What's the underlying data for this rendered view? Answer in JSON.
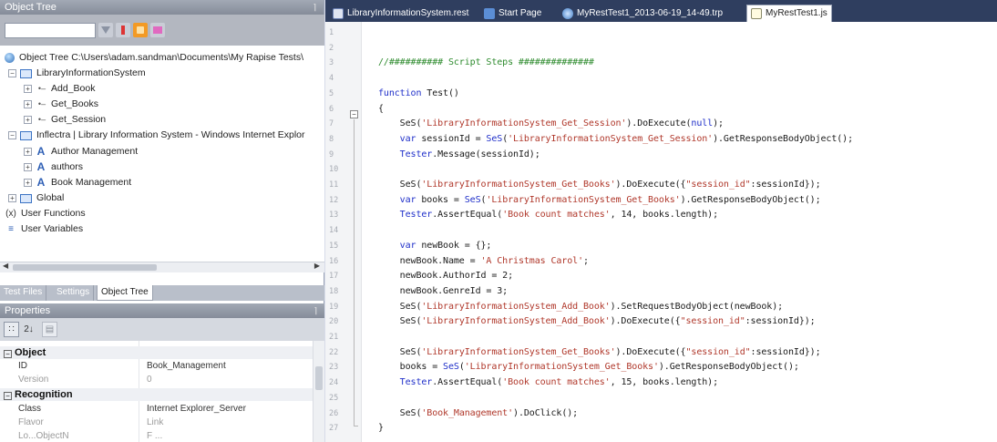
{
  "object_tree": {
    "title": "Object Tree",
    "pin_glyph": "⌉",
    "search_value": "",
    "nodes": [
      {
        "label": "Object Tree C:\\Users\\adam.sandman\\Documents\\My Rapise Tests\\",
        "icon": "database-icon"
      },
      {
        "label": "LibraryInformationSystem",
        "icon": "folder-icon",
        "expander": "−"
      },
      {
        "label": "Add_Book",
        "icon": "connection-icon",
        "expander": "+"
      },
      {
        "label": "Get_Books",
        "icon": "connection-icon",
        "expander": "+"
      },
      {
        "label": "Get_Session",
        "icon": "connection-icon",
        "expander": "+"
      },
      {
        "label": "Inflectra | Library Information System - Windows Internet Explor",
        "icon": "folder-icon",
        "expander": "−"
      },
      {
        "label": "Author Management",
        "icon": "a-icon",
        "expander": "+"
      },
      {
        "label": "authors",
        "icon": "a-icon",
        "expander": "+"
      },
      {
        "label": "Book Management",
        "icon": "a-icon",
        "expander": "+"
      },
      {
        "label": "Global",
        "icon": "folder-icon",
        "expander": "+"
      },
      {
        "label": "User Functions",
        "icon": "functions-icon"
      },
      {
        "label": "User Variables",
        "icon": "variables-icon"
      }
    ],
    "icon_glyphs": {
      "connection": "•–",
      "functions": "(x)",
      "variables": "≡"
    }
  },
  "left_tabs": [
    "Test Files",
    "Settings",
    "Object Tree"
  ],
  "properties": {
    "title": "Properties",
    "pin_glyph": "⌉",
    "toolbar": {
      "categorized_glyph": "∷",
      "sort_glyph": "2↓",
      "pages_glyph": "▤"
    },
    "categories": [
      {
        "name": "Object",
        "expander": "−",
        "rows": [
          {
            "name": "ID",
            "value": "Book_Management",
            "dim": false
          },
          {
            "name": "Version",
            "value": "0",
            "dim": true
          }
        ]
      },
      {
        "name": "Recognition",
        "expander": "−",
        "rows": [
          {
            "name": "Class",
            "value": "Internet Explorer_Server",
            "dim": false
          },
          {
            "name": "Flavor",
            "value": "Link",
            "dim": true
          },
          {
            "name": "Lo...ObjectN",
            "value": "F ...",
            "dim": true
          }
        ]
      }
    ]
  },
  "editor": {
    "tabs": [
      {
        "label": "LibraryInformationSystem.rest",
        "active": false
      },
      {
        "label": "Start Page",
        "active": false
      },
      {
        "label": "MyRestTest1_2013-06-19_14-49.trp",
        "active": false
      },
      {
        "label": "MyRestTest1.js",
        "active": true
      }
    ],
    "fold_glyph": "−",
    "lines": [
      {
        "n": "1",
        "parts": []
      },
      {
        "n": "2",
        "parts": []
      },
      {
        "n": "3",
        "parts": [
          {
            "c": "cm",
            "t": "//########## Script Steps ##############"
          }
        ]
      },
      {
        "n": "4",
        "parts": []
      },
      {
        "n": "5",
        "parts": [
          {
            "c": "kw",
            "t": "function "
          },
          {
            "c": "tx",
            "t": "Test()"
          }
        ]
      },
      {
        "n": "6",
        "parts": [
          {
            "c": "tx",
            "t": "{"
          }
        ]
      },
      {
        "n": "7",
        "parts": [
          {
            "c": "tx",
            "t": "    SeS("
          },
          {
            "c": "st",
            "t": "'LibraryInformationSystem_Get_Session'"
          },
          {
            "c": "tx",
            "t": ").DoExecute("
          },
          {
            "c": "kw",
            "t": "null"
          },
          {
            "c": "tx",
            "t": ");"
          }
        ]
      },
      {
        "n": "8",
        "parts": [
          {
            "c": "kw",
            "t": "    var "
          },
          {
            "c": "tx",
            "t": "sessionId = "
          },
          {
            "c": "kw",
            "t": "SeS"
          },
          {
            "c": "tx",
            "t": "("
          },
          {
            "c": "st",
            "t": "'LibraryInformationSystem_Get_Session'"
          },
          {
            "c": "tx",
            "t": ").GetResponseBodyObject();"
          }
        ]
      },
      {
        "n": "9",
        "parts": [
          {
            "c": "kw",
            "t": "    Tester"
          },
          {
            "c": "tx",
            "t": ".Message(sessionId);"
          }
        ]
      },
      {
        "n": "10",
        "parts": []
      },
      {
        "n": "11",
        "parts": [
          {
            "c": "tx",
            "t": "    SeS("
          },
          {
            "c": "st",
            "t": "'LibraryInformationSystem_Get_Books'"
          },
          {
            "c": "tx",
            "t": ").DoExecute({"
          },
          {
            "c": "st",
            "t": "\"session_id\""
          },
          {
            "c": "tx",
            "t": ":sessionId});"
          }
        ]
      },
      {
        "n": "12",
        "parts": [
          {
            "c": "kw",
            "t": "    var "
          },
          {
            "c": "tx",
            "t": "books = "
          },
          {
            "c": "kw",
            "t": "SeS"
          },
          {
            "c": "tx",
            "t": "("
          },
          {
            "c": "st",
            "t": "'LibraryInformationSystem_Get_Books'"
          },
          {
            "c": "tx",
            "t": ").GetResponseBodyObject();"
          }
        ]
      },
      {
        "n": "13",
        "parts": [
          {
            "c": "kw",
            "t": "    Tester"
          },
          {
            "c": "tx",
            "t": ".AssertEqual("
          },
          {
            "c": "st",
            "t": "'Book count matches'"
          },
          {
            "c": "tx",
            "t": ", 14, books.length);"
          }
        ]
      },
      {
        "n": "14",
        "parts": []
      },
      {
        "n": "15",
        "parts": [
          {
            "c": "kw",
            "t": "    var "
          },
          {
            "c": "tx",
            "t": "newBook = {};"
          }
        ]
      },
      {
        "n": "16",
        "parts": [
          {
            "c": "tx",
            "t": "    newBook.Name = "
          },
          {
            "c": "st",
            "t": "'A Christmas Carol'"
          },
          {
            "c": "tx",
            "t": ";"
          }
        ]
      },
      {
        "n": "17",
        "parts": [
          {
            "c": "tx",
            "t": "    newBook.AuthorId = 2;"
          }
        ]
      },
      {
        "n": "18",
        "parts": [
          {
            "c": "tx",
            "t": "    newBook.GenreId = 3;"
          }
        ]
      },
      {
        "n": "19",
        "parts": [
          {
            "c": "tx",
            "t": "    SeS("
          },
          {
            "c": "st",
            "t": "'LibraryInformationSystem_Add_Book'"
          },
          {
            "c": "tx",
            "t": ").SetRequestBodyObject(newBook);"
          }
        ]
      },
      {
        "n": "20",
        "parts": [
          {
            "c": "tx",
            "t": "    SeS("
          },
          {
            "c": "st",
            "t": "'LibraryInformationSystem_Add_Book'"
          },
          {
            "c": "tx",
            "t": ").DoExecute({"
          },
          {
            "c": "st",
            "t": "\"session_id\""
          },
          {
            "c": "tx",
            "t": ":sessionId});"
          }
        ]
      },
      {
        "n": "21",
        "parts": []
      },
      {
        "n": "22",
        "parts": [
          {
            "c": "tx",
            "t": "    SeS("
          },
          {
            "c": "st",
            "t": "'LibraryInformationSystem_Get_Books'"
          },
          {
            "c": "tx",
            "t": ").DoExecute({"
          },
          {
            "c": "st",
            "t": "\"session_id\""
          },
          {
            "c": "tx",
            "t": ":sessionId});"
          }
        ]
      },
      {
        "n": "23",
        "parts": [
          {
            "c": "tx",
            "t": "    books = "
          },
          {
            "c": "kw",
            "t": "SeS"
          },
          {
            "c": "tx",
            "t": "("
          },
          {
            "c": "st",
            "t": "'LibraryInformationSystem_Get_Books'"
          },
          {
            "c": "tx",
            "t": ").GetResponseBodyObject();"
          }
        ]
      },
      {
        "n": "24",
        "parts": [
          {
            "c": "kw",
            "t": "    Tester"
          },
          {
            "c": "tx",
            "t": ".AssertEqual("
          },
          {
            "c": "st",
            "t": "'Book count matches'"
          },
          {
            "c": "tx",
            "t": ", 15, books.length);"
          }
        ]
      },
      {
        "n": "25",
        "parts": []
      },
      {
        "n": "26",
        "parts": [
          {
            "c": "tx",
            "t": "    SeS("
          },
          {
            "c": "st",
            "t": "'Book_Management'"
          },
          {
            "c": "tx",
            "t": ").DoClick();"
          }
        ]
      },
      {
        "n": "27",
        "parts": [
          {
            "c": "tx",
            "t": "}"
          }
        ]
      }
    ]
  },
  "colors": {
    "comment": "#2e8b2e",
    "keyword": "#1f2fc9",
    "string": "#b0382b",
    "tab_strip": "#2f3e5f"
  }
}
